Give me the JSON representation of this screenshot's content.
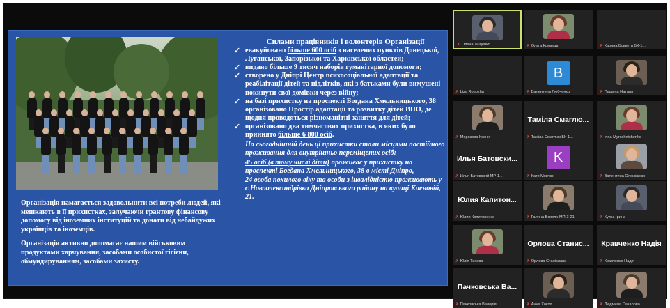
{
  "slide": {
    "heading": "Силами працівників і волонтерів Організації",
    "bullets": [
      {
        "pre": "евакуйовано ",
        "u": "більше 600 осіб",
        "post": " з населених пунктів Донецької, Луганської, Запорізької та Харківської областей;"
      },
      {
        "pre": "видано ",
        "u": "більше 9 тисяч",
        "post": " наборів гуманітарної допомоги;"
      },
      {
        "pre": "створено у Дніпрі Центр психосоціальної адаптації та реабілітації дітей та підлітків, які з батьками були вимушені покинути свої домівки через війну;",
        "u": "",
        "post": ""
      },
      {
        "pre": "на базі прихистку на проспекті Богдана Хмельницького, 38 організовано Простір адаптації та розвитку дітей ВПО, де щодня проводяться різноманітні заняття для дітей;",
        "u": "",
        "post": ""
      },
      {
        "pre": "організовано два тимчасових прихистка, в яких було прийнято ",
        "u": "більше 6 800 осіб",
        "post": "."
      }
    ],
    "note_intro": "На сьогоднішній день ці прихистки стали місцями постійного проживання для внутрішньо переміщених осіб:",
    "note_u1": "45 осіб (в тому числі діти)",
    "note_mid": " проживає у прихистку на проспекті Богдана Хмельницького, 38 в місті Дніпро,",
    "note_u2": "24 особа похилого віку та особи з інвалідністю",
    "note_end": " проживають у с.Новоолександрівка Дніпровського району на вулиці Кленовій, 21.",
    "left_p1": "Організація намагається задовольнити всі потреби людей, які мешкають в її прихистках, залучаючи грантову фінансову допомогу від іноземних інституцій та донати від небайдужих українців та іноземців.",
    "left_p2": "Організація активно допомагає нашим військовим продуктами харчування, засобами особистої гігієни, обмундируванням, засобами захисту."
  },
  "participants": [
    {
      "label": "Олена Тищенко",
      "type": "video",
      "active": true
    },
    {
      "label": "Ольга Кривець",
      "type": "video"
    },
    {
      "label": "Карина Бовкета БК-1...",
      "type": "none"
    },
    {
      "label": "Liza Rogozha",
      "type": "none"
    },
    {
      "label": "Валентина Любченко",
      "type": "avatar",
      "letter": "B",
      "color": "#2d8ad6"
    },
    {
      "label": "Пашина Наталя",
      "type": "video"
    },
    {
      "label": "Морозова Ксенія",
      "type": "video"
    },
    {
      "label": "Таміла Смаглюк БК-1...",
      "type": "text",
      "big": "Таміла Смаглю..."
    },
    {
      "label": "Irina Myroshnichenko",
      "type": "video"
    },
    {
      "label": "Илья Батовский МР-1...",
      "type": "text",
      "big": "Илья Батовски..."
    },
    {
      "label": "Катя Мовчан",
      "type": "avatar",
      "letter": "K",
      "color": "#9a3ec2"
    },
    {
      "label": "Валентина Олексієнко",
      "type": "video"
    },
    {
      "label": "Юлия Капитоненко",
      "type": "text",
      "big": "Юлия Капитон..."
    },
    {
      "label": "Галина Бохолн МП-3-21",
      "type": "video"
    },
    {
      "label": "Кутна Ірина",
      "type": "video"
    },
    {
      "label": "Юлія Тихова",
      "type": "video"
    },
    {
      "label": "Орлова Станіслава",
      "type": "text",
      "big": "Орлова Станис..."
    },
    {
      "label": "Кравченко Надія",
      "type": "text",
      "big": "Кравченко Надія"
    },
    {
      "label": "Пачковська Валерія...",
      "type": "text",
      "big": "Пачковська Ва..."
    },
    {
      "label": "Анна Хокод",
      "type": "video"
    },
    {
      "label": "Людмила Сахарова",
      "type": "video"
    }
  ],
  "colors": {
    "slide_bg": "#2a55a6",
    "active_border": "#c9e36a",
    "mic_muted": "#e0433b"
  }
}
